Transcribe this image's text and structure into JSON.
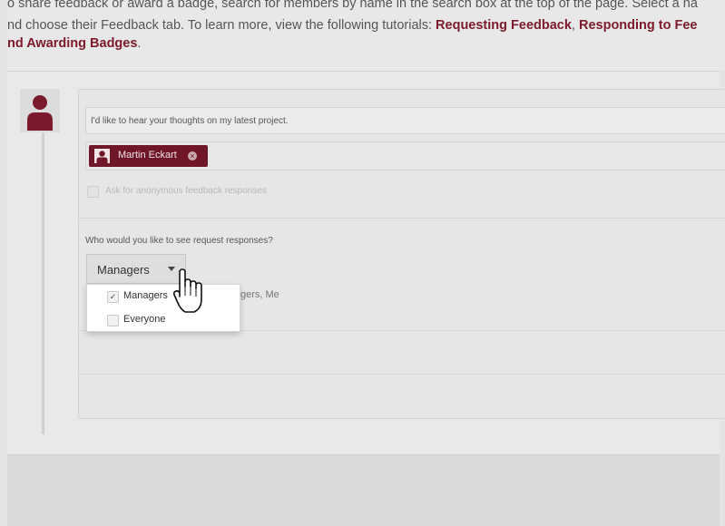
{
  "intro": {
    "line1": "o share feedback or award a badge, search for members by name in the search box at the top of the page. Select a na",
    "line2_prefix": "nd choose their Feedback tab. To learn more, view the following tutorials: ",
    "link_requesting": "Requesting Feedback",
    "comma": ", ",
    "link_responding": "Responding to Fee",
    "line3_link": "nd Awarding Badges",
    "line3_suffix": "."
  },
  "request": {
    "message_value": "I'd like to hear your thoughts on my latest project.",
    "recipient": {
      "name": "Martin Eckart",
      "remove_glyph": "×"
    },
    "anonymous_label": "Ask for anonymous feedback responses",
    "question": "Who would you like to see request responses?",
    "visibility_select": {
      "selected": "Managers"
    },
    "visibility_summary": "gers, Me"
  },
  "dropdown": {
    "options": [
      {
        "label": "Managers",
        "checked": true,
        "check_glyph": "✓"
      },
      {
        "label": "Everyone",
        "checked": false,
        "check_glyph": ""
      }
    ]
  },
  "colors": {
    "brand": "#6f1628",
    "link": "#7d1a2b"
  },
  "icons": [
    "user-avatar-icon",
    "remove-chip-icon",
    "caret-down-icon",
    "checkbox-icon",
    "hand-pointer-cursor-icon"
  ]
}
